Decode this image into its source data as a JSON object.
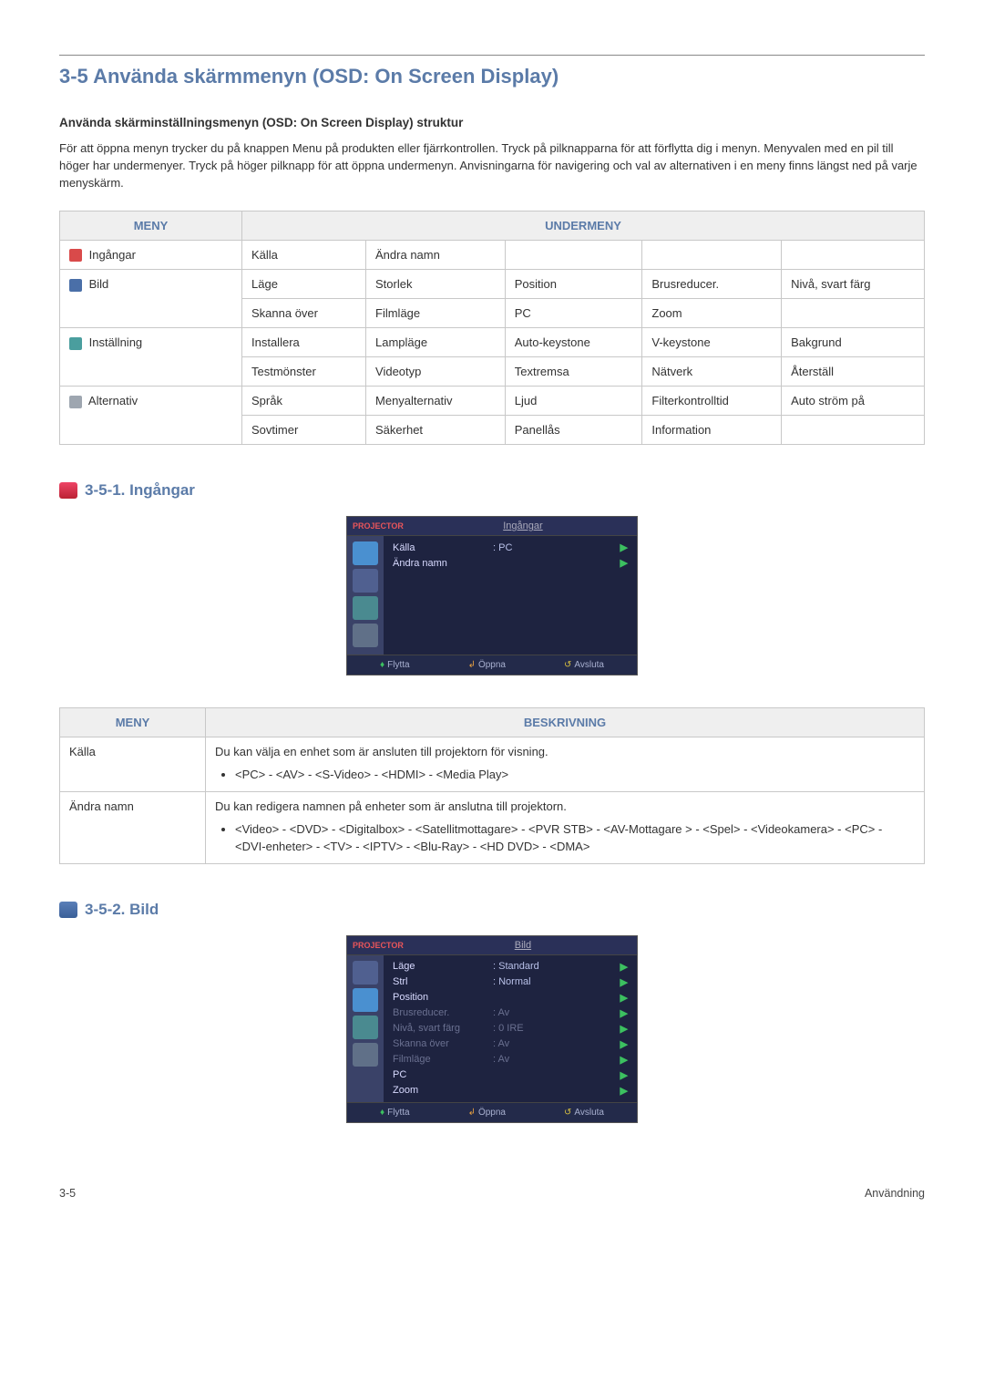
{
  "pageTitle": "3-5   Använda skärmmenyn (OSD: On Screen Display)",
  "introHeading": "Använda skärminställningsmenyn (OSD: On Screen Display) struktur",
  "introText": "För att öppna menyn trycker du på knappen Menu på produkten eller fjärrkontrollen. Tryck på pilknapparna för att förflytta dig i menyn. Menyvalen med en pil till höger har undermenyer. Tryck på höger pilknapp för att öppna undermenyn. Anvisningarna för navigering och val av alternativen i en meny finns längst ned på varje menyskärm.",
  "menuTable": {
    "headers": {
      "menu": "MENY",
      "submenu": "UNDERMENY"
    },
    "rows": [
      {
        "icon": "red",
        "menu": "Ingångar",
        "subs": [
          [
            "Källa",
            "Ändra namn",
            "",
            "",
            ""
          ]
        ]
      },
      {
        "icon": "blue",
        "menu": "Bild",
        "subs": [
          [
            "Läge",
            "Storlek",
            "Position",
            "Brusreducer.",
            "Nivå, svart färg"
          ],
          [
            "Skanna över",
            "Filmläge",
            "PC",
            "Zoom",
            ""
          ]
        ]
      },
      {
        "icon": "teal",
        "menu": "Inställning",
        "subs": [
          [
            "Installera",
            "Lampläge",
            "Auto-keystone",
            "V-keystone",
            "Bakgrund"
          ],
          [
            "Testmönster",
            "Videotyp",
            "Textremsa",
            "Nätverk",
            "Återställ"
          ]
        ]
      },
      {
        "icon": "gray",
        "menu": "Alternativ",
        "subs": [
          [
            "Språk",
            "Menyalternativ",
            "Ljud",
            "Filterkontrolltid",
            "Auto ström på"
          ],
          [
            "Sovtimer",
            "Säkerhet",
            "Panellås",
            "Information",
            ""
          ]
        ]
      }
    ]
  },
  "section1": {
    "heading": "3-5-1. Ingångar",
    "osd": {
      "tag": "PROJECTOR",
      "title": "Ingångar",
      "rows": [
        {
          "label": "Källa",
          "val": ": PC",
          "arrow": true
        },
        {
          "label": "Ändra namn",
          "val": "",
          "arrow": true
        }
      ],
      "footer": [
        "Flytta",
        "Öppna",
        "Avsluta"
      ]
    },
    "descTable": {
      "headers": {
        "menu": "MENY",
        "desc": "BESKRIVNING"
      },
      "rows": [
        {
          "menu": "Källa",
          "para": "Du kan välja en enhet som är ansluten till projektorn för visning.",
          "bullet": "<PC> - <AV> - <S-Video> - <HDMI> - <Media Play>"
        },
        {
          "menu": "Ändra namn",
          "para": "Du kan redigera namnen på enheter som är anslutna till projektorn.",
          "bullet": "<Video> - <DVD> - <Digitalbox> - <Satellitmottagare> - <PVR STB> - <AV-Mottagare > - <Spel> - <Videokamera> - <PC> - <DVI-enheter> - <TV> - <IPTV> - <Blu-Ray> - <HD DVD> - <DMA>"
        }
      ]
    }
  },
  "section2": {
    "heading": "3-5-2. Bild",
    "osd": {
      "tag": "PROJECTOR",
      "title": "Bild",
      "rows": [
        {
          "label": "Läge",
          "val": ": Standard",
          "arrow": true
        },
        {
          "label": "Strl",
          "val": ": Normal",
          "arrow": true
        },
        {
          "label": "Position",
          "val": "",
          "arrow": true
        },
        {
          "label": "Brusreducer.",
          "val": ": Av",
          "arrow": true,
          "dim": true
        },
        {
          "label": "Nivå, svart färg",
          "val": ": 0 IRE",
          "arrow": true,
          "dim": true
        },
        {
          "label": "Skanna över",
          "val": ": Av",
          "arrow": true,
          "dim": true
        },
        {
          "label": "Filmläge",
          "val": ": Av",
          "arrow": true,
          "dim": true
        },
        {
          "label": "PC",
          "val": "",
          "arrow": true
        },
        {
          "label": "Zoom",
          "val": "",
          "arrow": true
        }
      ],
      "footer": [
        "Flytta",
        "Öppna",
        "Avsluta"
      ]
    }
  },
  "footer": {
    "left": "3-5",
    "right": "Användning"
  }
}
